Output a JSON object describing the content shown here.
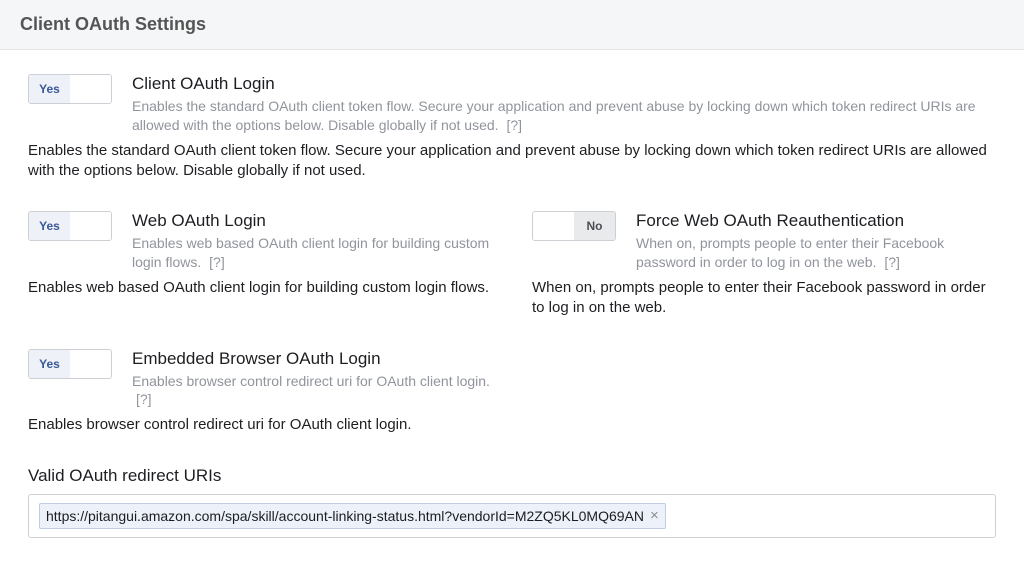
{
  "header": {
    "title": "Client OAuth Settings"
  },
  "toggle_labels": {
    "yes": "Yes",
    "no": "No"
  },
  "settings": {
    "client_oauth_login": {
      "title": "Client OAuth Login",
      "desc": "Enables the standard OAuth client token flow. Secure your application and prevent abuse by locking down which token redirect URIs are allowed with the options below. Disable globally if not used.",
      "help": "[?]",
      "extra": "Enables the standard OAuth client token flow. Secure your application and prevent abuse by locking down which token redirect URIs are allowed with the options below. Disable globally if not used.",
      "value": "yes"
    },
    "web_oauth_login": {
      "title": "Web OAuth Login",
      "desc": "Enables web based OAuth client login for building custom login flows.",
      "help": "[?]",
      "extra": "Enables web based OAuth client login for building custom login flows.",
      "value": "yes"
    },
    "force_reauth": {
      "title": "Force Web OAuth Reauthentication",
      "desc": "When on, prompts people to enter their Facebook password in order to log in on the web.",
      "help": "[?]",
      "extra": "When on, prompts people to enter their Facebook password in order to log in on the web.",
      "value": "no"
    },
    "embedded": {
      "title": "Embedded Browser OAuth Login",
      "desc": "Enables browser control redirect uri for OAuth client login.",
      "help": "[?]",
      "extra": "Enables browser control redirect uri for OAuth client login.",
      "value": "yes"
    }
  },
  "redirect_section": {
    "label": "Valid OAuth redirect URIs",
    "tokens": [
      "https://pitangui.amazon.com/spa/skill/account-linking-status.html?vendorId=M2ZQ5KL0MQ69AN"
    ],
    "remove_glyph": "×"
  }
}
